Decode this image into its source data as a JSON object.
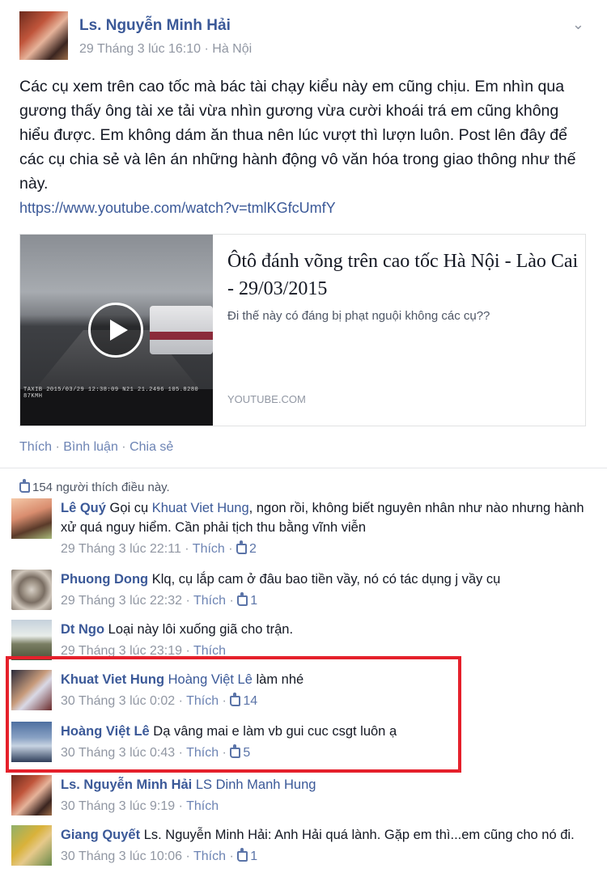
{
  "post": {
    "author": "Ls. Nguyễn Minh Hải",
    "timestamp": "29 Tháng 3 lúc 16:10",
    "location": "Hà Nội",
    "meta_sep": " · ",
    "text": "Các cụ xem trên cao tốc mà bác tài chạy kiểu này em cũng chịu. Em nhìn qua gương thấy ông tài xe tải vừa nhìn gương vừa cười khoái trá em cũng không hiểu được. Em không dám ăn thua nên lúc vượt thì lượn luôn. Post lên đây để các cụ chia sẻ và lên án những hành động vô văn hóa trong giao thông như thế này.",
    "link": "https://www.youtube.com/watch?v=tmlKGfcUmfY"
  },
  "card": {
    "title": "Ôtô đánh võng trên cao tốc Hà Nội - Lào Cai - 29/03/2015",
    "description": "Đi thế này có đáng bị phạt nguội không các cụ??",
    "source": "YOUTUBE.COM",
    "video_overlay": "TAXIB 2015/03/29 12:38:09 N21 21.2496 105.8280 87KMH"
  },
  "actions": {
    "like": "Thích",
    "comment": "Bình luận",
    "share": "Chia sẻ",
    "sep": " · "
  },
  "likes_summary": "154 người thích điều này.",
  "comments": [
    {
      "name": "Lê Quý",
      "text_before": " Gọi cụ ",
      "mention": "Khuat Viet Hung",
      "text_after": ", ngon rồi, không biết nguyên nhân như nào nhưng hành xử quá nguy hiểm. Cần phải tịch thu bằng vĩnh viễn",
      "time": "29 Tháng 3 lúc 22:11",
      "like_label": "Thích",
      "likes": "2"
    },
    {
      "name": "Phuong Dong",
      "text_before": " Klq, cụ lắp cam ở đâu bao tiền vầy, nó có tác dụng j vầy cụ",
      "mention": "",
      "text_after": "",
      "time": "29 Tháng 3 lúc 22:32",
      "like_label": "Thích",
      "likes": "1"
    },
    {
      "name": "Dt Ngo",
      "text_before": " Loại này lôi xuống giã cho trận.",
      "mention": "",
      "text_after": "",
      "time": "29 Tháng 3 lúc 23:19",
      "like_label": "Thích",
      "likes": ""
    },
    {
      "name": "Khuat Viet Hung",
      "text_before": " ",
      "mention": "Hoàng Việt Lê",
      "text_after": " làm nhé",
      "time": "30 Tháng 3 lúc 0:02",
      "like_label": "Thích",
      "likes": "14"
    },
    {
      "name": "Hoàng Việt Lê",
      "text_before": " Dạ vâng mai e làm vb gui cuc csgt luôn ạ",
      "mention": "",
      "text_after": "",
      "time": "30 Tháng 3 lúc 0:43",
      "like_label": "Thích",
      "likes": "5"
    },
    {
      "name": "Ls. Nguyễn Minh Hải",
      "text_before": " ",
      "mention": "LS Dinh Manh Hung",
      "text_after": "",
      "time": "30 Tháng 3 lúc 9:19",
      "like_label": "Thích",
      "likes": ""
    },
    {
      "name": "Giang Quyết",
      "text_before": " Ls. Nguyễn Minh Hải: Anh Hải quá lành. Gặp em thì...em cũng cho nó đi.",
      "mention": "",
      "text_after": "",
      "time": "30 Tháng 3 lúc 10:06",
      "like_label": "Thích",
      "likes": "1"
    }
  ],
  "colors": {
    "link": "#3b5998",
    "highlight": "#e5202b",
    "meta": "#9197a3"
  }
}
